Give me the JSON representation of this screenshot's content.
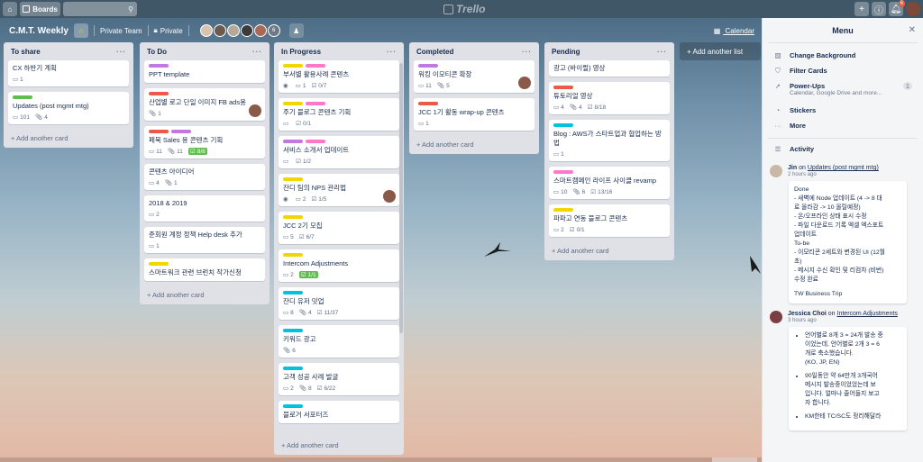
{
  "topbar": {
    "boards_label": "Boards",
    "logo_text": "Trello",
    "notification_count": "6",
    "icons": [
      "home-icon",
      "boards-icon",
      "search-icon",
      "plus-icon",
      "info-icon",
      "bell-icon"
    ]
  },
  "board": {
    "title": "C.M.T. Weekly",
    "team_label": "Private Team",
    "visibility_label": "Private",
    "member_count": "6",
    "calendar_label": "Calendar",
    "add_list_label": "+ Add another list"
  },
  "lists": [
    {
      "name": "To share",
      "add_label": "+ Add another card",
      "cards": [
        {
          "title": "CX 하반기 계획",
          "labels": [],
          "badges": [
            {
              "icon": "comment",
              "text": "1"
            }
          ]
        },
        {
          "title": "Updates (post mgmt mtg)",
          "labels": [
            "#61bd4f"
          ],
          "badges": [
            {
              "icon": "comment",
              "text": "101"
            },
            {
              "icon": "attach",
              "text": "4"
            }
          ]
        }
      ]
    },
    {
      "name": "To Do",
      "add_label": "+ Add another card",
      "cards": [
        {
          "title": "PPT template",
          "labels": [
            "#c377e0"
          ],
          "badges": []
        },
        {
          "title": "산업별 로고 단일 이미지 FB ads용",
          "labels": [
            "#eb5a46"
          ],
          "badges": [
            {
              "icon": "attach",
              "text": "1"
            }
          ],
          "avatar": true
        },
        {
          "title": "페북 Sales 용 콘텐츠 기획",
          "labels": [
            "#eb5a46",
            "#c377e0"
          ],
          "badges": [
            {
              "icon": "comment",
              "text": "11"
            },
            {
              "icon": "attach",
              "text": "11"
            },
            {
              "icon": "check",
              "text": "8/8",
              "done": true
            }
          ]
        },
        {
          "title": "콘텐츠 아이디어",
          "labels": [],
          "badges": [
            {
              "icon": "comment",
              "text": "4"
            },
            {
              "icon": "attach",
              "text": "1"
            }
          ]
        },
        {
          "title": "2018 & 2019",
          "labels": [],
          "badges": [
            {
              "icon": "comment",
              "text": "2"
            }
          ]
        },
        {
          "title": "준회원 계정 정책 Help desk 추가",
          "labels": [],
          "badges": [
            {
              "icon": "comment",
              "text": "1"
            }
          ]
        },
        {
          "title": "스마트워크 관련 브런치 작가신청",
          "labels": [
            "#f2d600"
          ],
          "badges": []
        }
      ]
    },
    {
      "name": "In Progress",
      "add_label": "+ Add another card",
      "cards": [
        {
          "title": "부서별 활용사례 콘텐츠",
          "labels": [
            "#f2d600",
            "#ff78cb"
          ],
          "badges": [
            {
              "icon": "eye",
              "text": ""
            },
            {
              "icon": "comment",
              "text": "1"
            },
            {
              "icon": "check",
              "text": "0/7"
            }
          ]
        },
        {
          "title": "주기 블로그 콘텐츠 기획",
          "labels": [
            "#f2d600",
            "#ff78cb"
          ],
          "badges": [
            {
              "icon": "comment",
              "text": ""
            },
            {
              "icon": "check",
              "text": "0/1"
            }
          ]
        },
        {
          "title": "서비스 소개서 업데이트",
          "labels": [
            "#c377e0",
            "#ff78cb"
          ],
          "badges": [
            {
              "icon": "comment",
              "text": ""
            },
            {
              "icon": "check",
              "text": "1/2"
            }
          ]
        },
        {
          "title": "잔디 팀의 NPS 관리법",
          "labels": [
            "#f2d600"
          ],
          "badges": [
            {
              "icon": "eye",
              "text": ""
            },
            {
              "icon": "comment",
              "text": "2"
            },
            {
              "icon": "check",
              "text": "1/5"
            }
          ],
          "avatar": true
        },
        {
          "title": "JCC 2기 모집",
          "labels": [
            "#f2d600"
          ],
          "badges": [
            {
              "icon": "comment",
              "text": "5"
            },
            {
              "icon": "check",
              "text": "6/7"
            }
          ]
        },
        {
          "title": "Intercom Adjustments",
          "labels": [
            "#f2d600"
          ],
          "badges": [
            {
              "icon": "comment",
              "text": "2"
            },
            {
              "icon": "check",
              "text": "1/1",
              "done": true
            }
          ]
        },
        {
          "title": "잔디 유저 밋업",
          "labels": [
            "#00c2e0"
          ],
          "badges": [
            {
              "icon": "comment",
              "text": "8"
            },
            {
              "icon": "attach",
              "text": "4"
            },
            {
              "icon": "check",
              "text": "11/37"
            }
          ]
        },
        {
          "title": "키워드 광고",
          "labels": [
            "#00c2e0"
          ],
          "badges": [
            {
              "icon": "attach",
              "text": "6"
            }
          ]
        },
        {
          "title": "고객 성공 사례 발굴",
          "labels": [
            "#00c2e0"
          ],
          "badges": [
            {
              "icon": "comment",
              "text": "2"
            },
            {
              "icon": "attach",
              "text": "8"
            },
            {
              "icon": "check",
              "text": "6/22"
            }
          ]
        },
        {
          "title": "블로거 서포터즈",
          "labels": [
            "#00c2e0"
          ],
          "badges": []
        }
      ]
    },
    {
      "name": "Completed",
      "add_label": "+ Add another card",
      "cards": [
        {
          "title": "워킹 이모티콘 확장",
          "labels": [
            "#c377e0"
          ],
          "badges": [
            {
              "icon": "comment",
              "text": "11"
            },
            {
              "icon": "attach",
              "text": "5"
            }
          ],
          "avatar": true
        },
        {
          "title": "JCC 1기 활동 wrap-up 콘텐츠",
          "labels": [
            "#eb5a46"
          ],
          "badges": [
            {
              "icon": "comment",
              "text": "1"
            }
          ]
        }
      ]
    },
    {
      "name": "Pending",
      "add_label": "+ Add another card",
      "cards": [
        {
          "title": "광고 (바이럴) 영상",
          "labels": [],
          "badges": []
        },
        {
          "title": "튜토리얼 영상",
          "labels": [
            "#eb5a46"
          ],
          "badges": [
            {
              "icon": "comment",
              "text": "4"
            },
            {
              "icon": "attach",
              "text": "4"
            },
            {
              "icon": "check",
              "text": "8/18"
            }
          ]
        },
        {
          "title": "Blog : AWS가 스타트업과 협업하는 방법",
          "labels": [
            "#00c2e0"
          ],
          "badges": [
            {
              "icon": "comment",
              "text": "1"
            }
          ]
        },
        {
          "title": "스마트캠페인 라이프 사이클 revamp",
          "labels": [
            "#ff78cb"
          ],
          "badges": [
            {
              "icon": "comment",
              "text": "10"
            },
            {
              "icon": "attach",
              "text": "6"
            },
            {
              "icon": "check",
              "text": "13/16"
            }
          ]
        },
        {
          "title": "파파고 연동 블로그 콘텐츠",
          "labels": [
            "#f2d600"
          ],
          "badges": [
            {
              "icon": "comment",
              "text": "2"
            },
            {
              "icon": "check",
              "text": "0/1"
            }
          ]
        }
      ]
    }
  ],
  "menu": {
    "title": "Menu",
    "items": [
      {
        "label": "Change Background",
        "icon": "background-icon"
      },
      {
        "label": "Filter Cards",
        "icon": "filter-icon"
      },
      {
        "label": "Power-Ups",
        "icon": "rocket-icon",
        "sub": "Calendar, Google Drive and more...",
        "count": "1"
      },
      {
        "label": "Stickers",
        "icon": "sticker-icon"
      },
      {
        "label": "More",
        "icon": "more-icon"
      }
    ],
    "activity_label": "Activity",
    "activity": [
      {
        "user": "Jin",
        "on": "on",
        "card": "Updates (post mgmt mtg)",
        "time": "2 hours ago",
        "lines": [
          "Done",
          "- 새벽에 Node 업데이트 (4 -> 8 대",
          "로 올라감 -> 10 올릴예정)",
          "- 온/오프라인 상태 표시 수정",
          "- 파일 다운로드 기록 엑셀 엑스포트",
          "업데이트",
          "To-be",
          "- 이모티콘 2세트와 변경된 UI (12월",
          "초)",
          "- 메시지 수신 확인 및 리컴차 (비번)",
          "수정 완료",
          "",
          "TW Business Trip"
        ]
      },
      {
        "user": "Jessica Choi",
        "on": "on",
        "card": "Intercom Adjustments",
        "time": "3 hours ago",
        "bullets": [
          [
            "언어별로 8개 3 = 24개 발송 중",
            "이었는데, 언어별로 2개 3 = 6",
            "개로 축소했습니다.",
            "(KO, JP, EN)"
          ],
          [
            "90일동안 약 64만개 3개국어",
            "메시지 발송중이었었는데 보",
            "입니다. 얼마나 줄어들지 보고",
            "자 합니다."
          ],
          [
            "KM한테 TC/SC도 정리해달라"
          ]
        ]
      }
    ]
  }
}
